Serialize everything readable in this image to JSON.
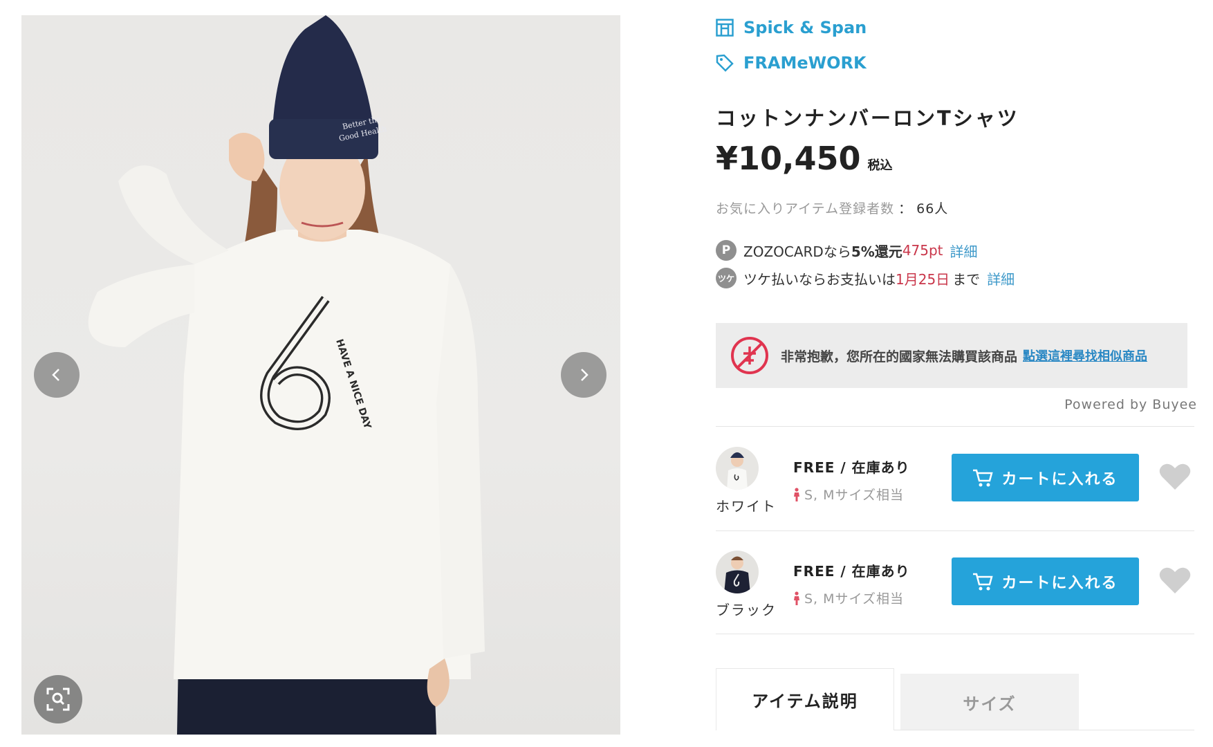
{
  "shop": {
    "name": "Spick & Span",
    "icon": "shop-icon"
  },
  "brand": {
    "name": "FRAMeWORK",
    "icon": "tag-icon"
  },
  "product": {
    "title": "コットンナンバーロンTシャツ",
    "price": "¥10,450",
    "tax_label": "税込",
    "favorite_label": "お気に入りアイテム登録者数",
    "favorite_separator": "：",
    "favorite_count": "66人"
  },
  "payments": {
    "zozocard": {
      "badge": "P",
      "prefix": "ZOZOCARDなら",
      "rate": "5%還元",
      "points": "475pt",
      "detail_link": "詳細"
    },
    "tsuke": {
      "badge": "ツケ",
      "prefix": "ツケ払いならお支払いは",
      "date": "1月25日",
      "suffix": "まで",
      "detail_link": "詳細"
    }
  },
  "notice": {
    "message": "非常抱歉，您所在的國家無法購買該商品",
    "link": "點選這裡尋找相似商品",
    "powered_by": "Powered by Buyee"
  },
  "variants": [
    {
      "color": "ホワイト",
      "size_stock": "FREE / 在庫あり",
      "fit": "S, Mサイズ相当",
      "cart_label": "カートに入れる"
    },
    {
      "color": "ブラック",
      "size_stock": "FREE / 在庫あり",
      "fit": "S, Mサイズ相当",
      "cart_label": "カートに入れる"
    }
  ],
  "tabs": [
    {
      "label": "アイテム説明",
      "active": true
    },
    {
      "label": "サイズ",
      "active": false
    }
  ],
  "colors": {
    "accent_link": "#2a9fd0",
    "cart_button": "#25a3da",
    "highlight_red": "#c9364a",
    "notice_bg": "#ececec"
  }
}
